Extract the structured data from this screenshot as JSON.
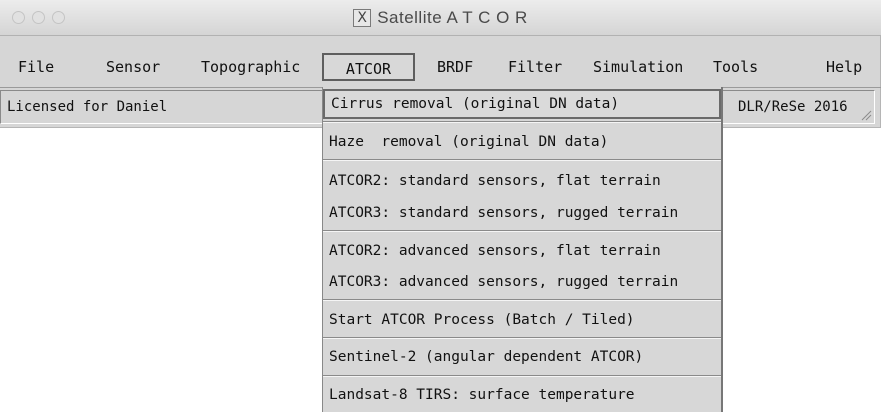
{
  "window": {
    "title": "Satellite A T C O R",
    "title_icon": "x11-icon"
  },
  "menubar": {
    "items": [
      {
        "label": "File"
      },
      {
        "label": "Sensor"
      },
      {
        "label": "Topographic"
      },
      {
        "label": "ATCOR",
        "active": true
      },
      {
        "label": "BRDF"
      },
      {
        "label": "Filter"
      },
      {
        "label": "Simulation"
      },
      {
        "label": "Tools"
      },
      {
        "label": "Help"
      }
    ]
  },
  "status": {
    "left": "Licensed for Daniel",
    "right": "DLR/ReSe 2016"
  },
  "dropdown": {
    "items": [
      {
        "label": "Cirrus removal (original DN data)",
        "highlighted": true
      },
      {
        "label": "Haze  removal (original DN data)"
      },
      {
        "label": "ATCOR2: standard sensors, flat terrain"
      },
      {
        "label": "ATCOR3: standard sensors, rugged terrain"
      },
      {
        "label": "ATCOR2: advanced sensors, flat terrain"
      },
      {
        "label": "ATCOR3: advanced sensors, rugged terrain"
      },
      {
        "label": "Start ATCOR Process (Batch / Tiled)"
      },
      {
        "label": "Sentinel-2 (angular dependent ATCOR)"
      },
      {
        "label": "Landsat-8 TIRS: surface temperature"
      }
    ]
  }
}
